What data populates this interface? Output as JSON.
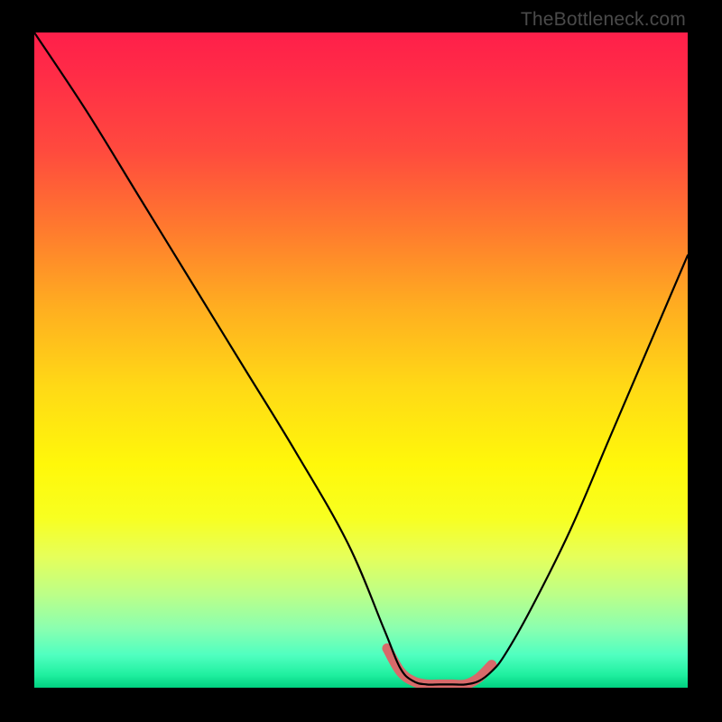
{
  "watermark": "TheBottleneck.com",
  "chart_data": {
    "type": "line",
    "title": "",
    "xlabel": "",
    "ylabel": "",
    "xlim": [
      0,
      100
    ],
    "ylim": [
      0,
      100
    ],
    "series": [
      {
        "name": "bottleneck-curve",
        "x": [
          0,
          8,
          16,
          24,
          32,
          40,
          48,
          53.5,
          56,
          58,
          60,
          62,
          64,
          66,
          68,
          70,
          72,
          76,
          82,
          88,
          94,
          100
        ],
        "y": [
          100,
          88,
          75,
          62,
          49,
          36,
          22,
          9,
          3,
          1,
          0.5,
          0.5,
          0.5,
          0.5,
          1,
          2.5,
          5,
          12,
          24,
          38,
          52,
          66
        ]
      },
      {
        "name": "highlight-band",
        "x": [
          54,
          56,
          58,
          60,
          62,
          64,
          66,
          68,
          70
        ],
        "y": [
          6,
          2.5,
          1,
          0.5,
          0.5,
          0.5,
          0.5,
          1.5,
          3.5
        ]
      }
    ]
  }
}
